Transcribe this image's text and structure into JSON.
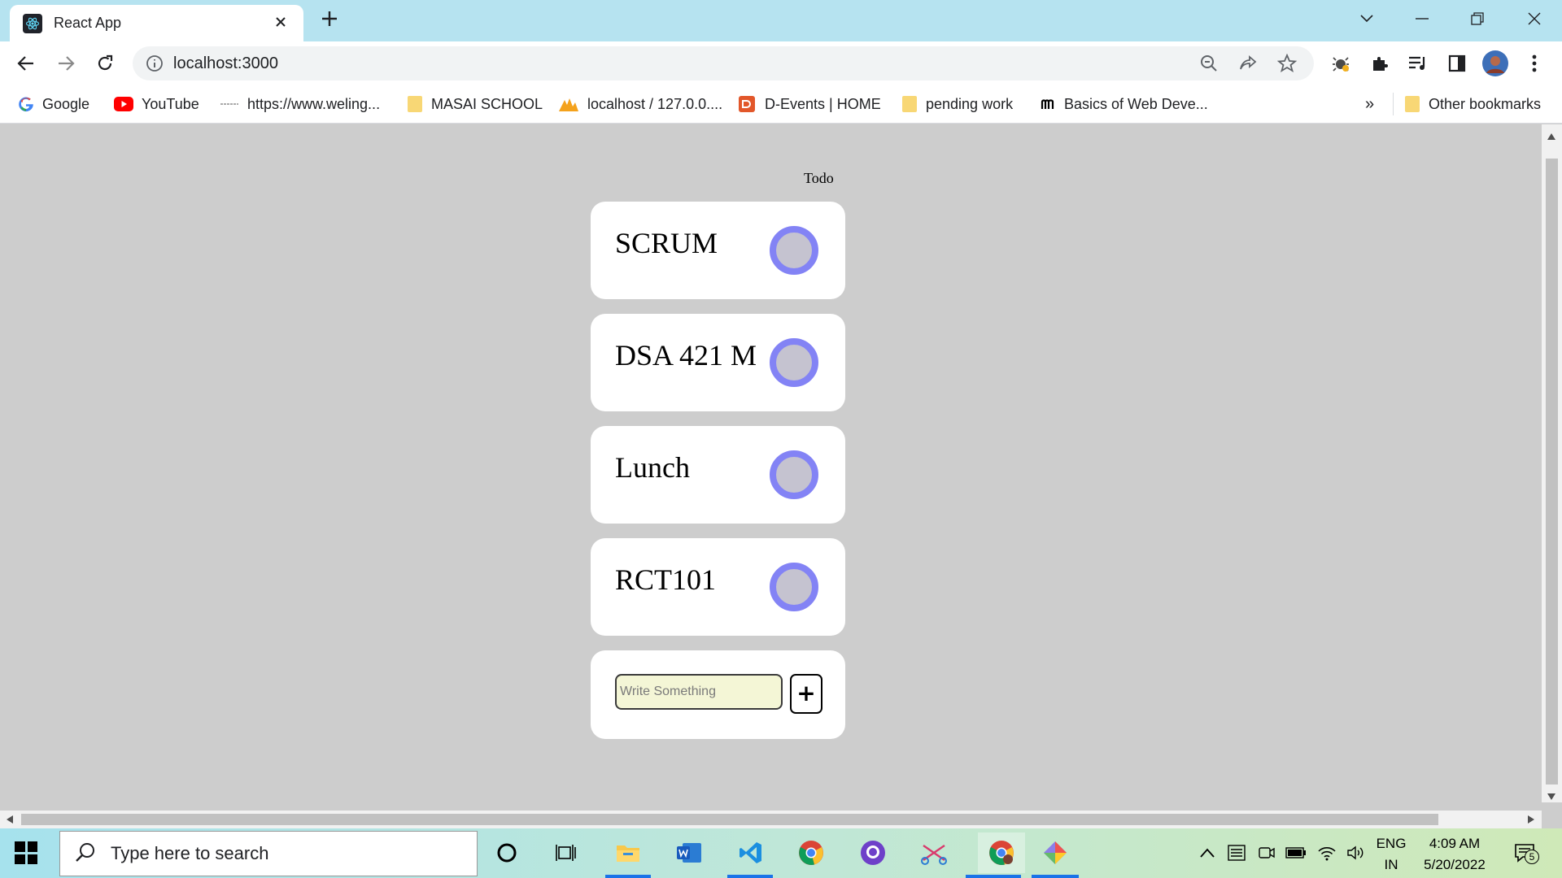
{
  "browser": {
    "tab_title": "React App",
    "url": "localhost:3000",
    "bookmarks": [
      {
        "label": "Google"
      },
      {
        "label": "YouTube"
      },
      {
        "label": "https://www.weling..."
      },
      {
        "label": "MASAI SCHOOL"
      },
      {
        "label": "localhost / 127.0.0...."
      },
      {
        "label": "D-Events | HOME"
      },
      {
        "label": "pending work"
      },
      {
        "label": "Basics of Web Deve..."
      }
    ],
    "overflow_label": "»",
    "other_bookmarks": "Other bookmarks"
  },
  "app": {
    "title": "Todo",
    "todos": [
      {
        "text": "SCRUM"
      },
      {
        "text": "DSA 421 M"
      },
      {
        "text": "Lunch"
      },
      {
        "text": "RCT101"
      }
    ],
    "input_placeholder": "Write Something",
    "add_label": "+",
    "toggle_color": "#8383f5"
  },
  "taskbar": {
    "search_placeholder": "Type here to search",
    "lang": "ENG",
    "region": "IN",
    "time": "4:09 AM",
    "date": "5/20/2022",
    "notification_count": "5"
  }
}
